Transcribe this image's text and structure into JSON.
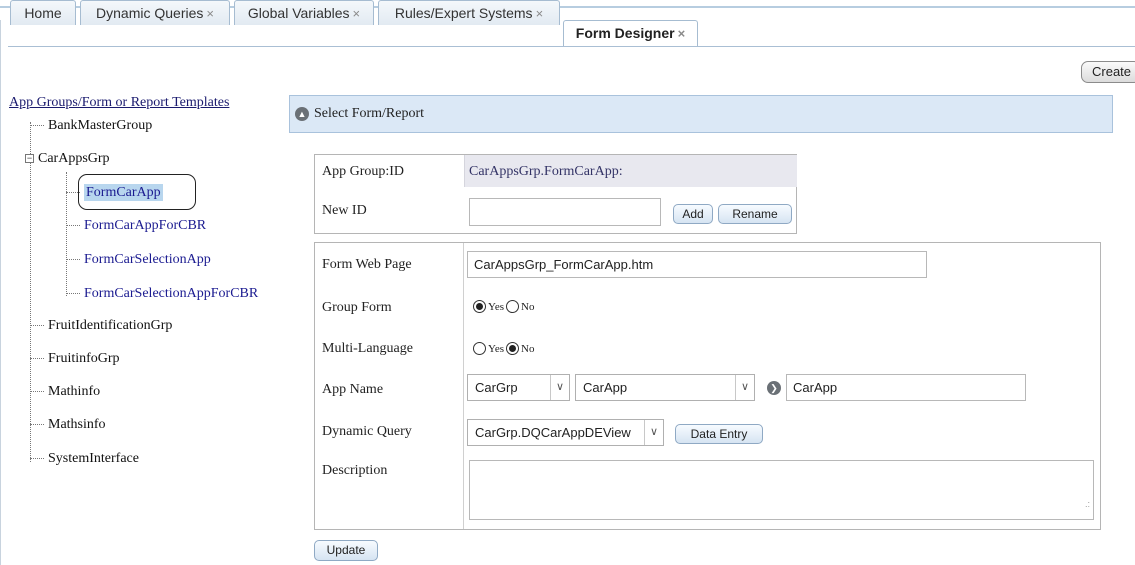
{
  "tabs": [
    {
      "label": "Home",
      "closable": false
    },
    {
      "label": "Dynamic Queries",
      "closable": true
    },
    {
      "label": "Global Variables",
      "closable": true
    },
    {
      "label": "Rules/Expert Systems",
      "closable": true
    },
    {
      "label": "Form Designer",
      "closable": true,
      "active": true
    }
  ],
  "close_glyph": "×",
  "toolbar": {
    "create_label": "Create"
  },
  "tree": {
    "root_label": "App Groups/Form or Report Templates",
    "items": [
      "BankMasterGroup",
      "CarAppsGrp",
      "FruitIdentificationGrp",
      "FruitinfoGrp",
      "Mathinfo",
      "Mathsinfo",
      "SystemInterface"
    ],
    "expanded_children": [
      "FormCarApp",
      "FormCarAppForCBR",
      "FormCarSelectionApp",
      "FormCarSelectionAppForCBR"
    ],
    "selected": "FormCarApp",
    "expander_glyph": "−"
  },
  "panel": {
    "title": "Select Form/Report",
    "icon": "collapse-up-icon"
  },
  "id_section": {
    "app_group_label": "App Group:ID",
    "app_group_value": "CarAppsGrp.FormCarApp:",
    "new_id_label": "New ID",
    "new_id_value": "",
    "add_label": "Add",
    "rename_label": "Rename"
  },
  "form": {
    "web_page_label": "Form Web Page",
    "web_page_value": "CarAppsGrp_FormCarApp.htm",
    "group_form_label": "Group Form",
    "multi_language_label": "Multi-Language",
    "yes_label": "Yes",
    "no_label": "No",
    "group_form_value": "Yes",
    "multi_language_value": "No",
    "app_name_label": "App Name",
    "app_group_select": "CarGrp",
    "app_select": "CarApp",
    "app_name_value": "CarApp",
    "dynamic_query_label": "Dynamic Query",
    "dynamic_query_value": "CarGrp.DQCarAppDEView",
    "data_entry_label": "Data Entry",
    "description_label": "Description",
    "description_value": "",
    "caret_glyph": "∨",
    "arrow_glyph": "❯",
    "resize_glyph": ".:"
  },
  "update_label": "Update",
  "colors": {
    "panel_header_bg": "#dbe8f6",
    "selected_bg": "#b8d6ee",
    "link": "#1a1a90"
  }
}
